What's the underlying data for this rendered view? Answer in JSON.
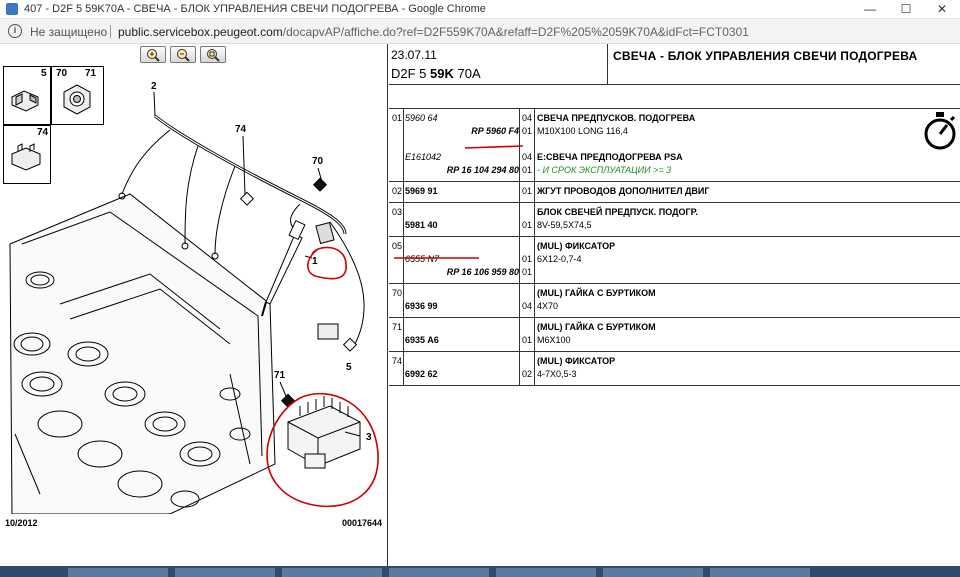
{
  "browser": {
    "window_title": "407 - D2F 5 59K70A - СВЕЧА - БЛОК УПРАВЛЕНИЯ СВЕЧИ ПОДОГРЕВА - Google Chrome",
    "security_label": "Не защищено",
    "url_host": "public.servicebox.peugeot.com",
    "url_path": "/docapvAP/affiche.do?ref=D2F559K70A&refaff=D2F%205%2059K70A&idFct=FCT0301",
    "buttons": {
      "minimize": "—",
      "maximize": "☐",
      "close": "✕"
    }
  },
  "diagram": {
    "thumb_labels": [
      "5",
      "70",
      "71",
      "74"
    ],
    "callouts": [
      "2",
      "74",
      "70",
      "1",
      "5",
      "71",
      "3"
    ],
    "footer_date": "10/2012",
    "footer_ref": "00017644"
  },
  "header": {
    "date": "23.07.11",
    "code_prefix": "D2F 5 ",
    "code_bold": "59K",
    "code_suffix": " 70A",
    "title": "СВЕЧА - БЛОК УПРАВЛЕНИЯ СВЕЧИ ПОДОГРЕВА"
  },
  "parts": [
    {
      "idx": "01",
      "lines": [
        {
          "ref": "5960 64",
          "ref_style": "i",
          "qty": "04",
          "desc": "СВЕЧА ПРЕДПУСКОВ. ПОДОГРЕВА",
          "desc_style": "b"
        },
        {
          "ref": "RP 5960 F4",
          "ref_style": "i b right",
          "qty": "01",
          "desc": "M10X100 LONG 116,4",
          "desc_style": ""
        },
        {
          "ref": "",
          "ref_style": "",
          "qty": "",
          "desc": "",
          "desc_style": ""
        },
        {
          "ref": "E161042",
          "ref_style": "i",
          "qty": "04",
          "desc": "E:СВЕЧА ПРЕДПОДОГРЕВА PSA",
          "desc_style": "b"
        },
        {
          "ref": "RP 16 104 294 80",
          "ref_style": "i b right",
          "qty": "01",
          "desc": "- И СРОК ЭКСПЛУАТАЦИИ >= 3",
          "desc_style": "g"
        }
      ]
    },
    {
      "idx": "02",
      "lines": [
        {
          "ref": "5969 91",
          "ref_style": "b",
          "qty": "01",
          "desc": "ЖГУТ ПРОВОДОВ ДОПОЛНИТЕЛ ДВИГ",
          "desc_style": "b"
        }
      ]
    },
    {
      "idx": "03",
      "lines": [
        {
          "ref": "",
          "ref_style": "",
          "qty": "",
          "desc": "БЛОК СВЕЧЕЙ ПРЕДПУСК. ПОДОГР.",
          "desc_style": "b"
        },
        {
          "ref": "5981 40",
          "ref_style": "b",
          "qty": "01",
          "desc": "8V-59,5X74,5",
          "desc_style": ""
        }
      ]
    },
    {
      "idx": "05",
      "lines": [
        {
          "ref": "",
          "ref_style": "",
          "qty": "",
          "desc": "(MUL) ФИКСАТОР",
          "desc_style": "b"
        },
        {
          "ref": "6555 N7",
          "ref_style": "i",
          "qty": "01",
          "desc": "6X12-0,7-4",
          "desc_style": ""
        },
        {
          "ref": "RP 16 106 959 80",
          "ref_style": "i b right",
          "qty": "01",
          "desc": "",
          "desc_style": ""
        }
      ]
    },
    {
      "idx": "70",
      "lines": [
        {
          "ref": "",
          "ref_style": "",
          "qty": "",
          "desc": "(MUL) ГАЙКА С БУРТИКОМ",
          "desc_style": "b"
        },
        {
          "ref": "6936 99",
          "ref_style": "b",
          "qty": "04",
          "desc": "4X70",
          "desc_style": ""
        }
      ]
    },
    {
      "idx": "71",
      "lines": [
        {
          "ref": "",
          "ref_style": "",
          "qty": "",
          "desc": "(MUL) ГАЙКА С БУРТИКОМ",
          "desc_style": "b"
        },
        {
          "ref": "6935 A6",
          "ref_style": "b",
          "qty": "01",
          "desc": "M6X100",
          "desc_style": ""
        }
      ]
    },
    {
      "idx": "74",
      "lines": [
        {
          "ref": "",
          "ref_style": "",
          "qty": "",
          "desc": "(MUL) ФИКСАТОР",
          "desc_style": "b"
        },
        {
          "ref": "6992 62",
          "ref_style": "b",
          "qty": "02",
          "desc": "4-7X0,5-3",
          "desc_style": ""
        }
      ]
    }
  ],
  "icons": {
    "stopwatch": "stopwatch-icon",
    "zoom_in": "zoom-in-icon",
    "zoom_out": "zoom-out-icon",
    "zoom_fit": "zoom-fit-icon"
  },
  "colors": {
    "annotation_red": "#cc0000",
    "accent_green": "#1d8f1d"
  }
}
